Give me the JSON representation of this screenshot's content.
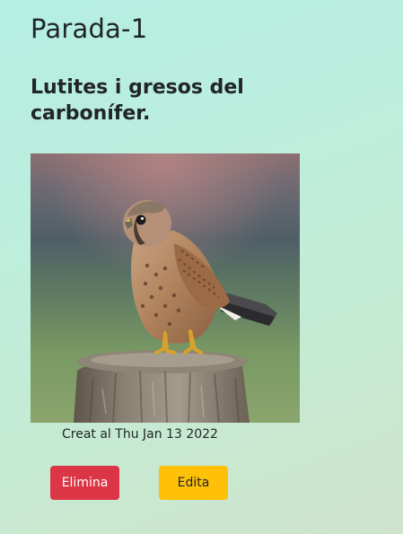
{
  "stop": {
    "title": "Parada-1",
    "description": "Lutites i gresos del carbonífer.",
    "image_subject": "kestrel-on-wooden-post",
    "created_label": "Creat al Thu Jan 13 2022"
  },
  "actions": {
    "delete_label": "Elimina",
    "edit_label": "Edita",
    "delete_color": "#dc3545",
    "edit_color": "#ffc107"
  }
}
